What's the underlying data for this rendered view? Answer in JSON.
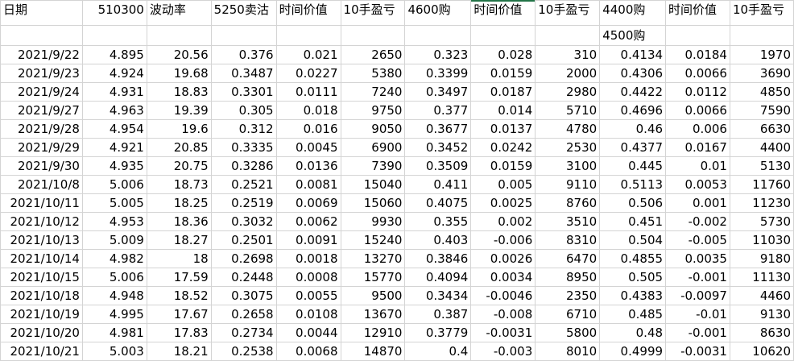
{
  "headers": [
    "日期",
    "510300",
    "波动率",
    "5250卖沽",
    "时间价值",
    "10手盈亏",
    "4600购",
    "时间价值",
    "10手盈亏",
    "4400购",
    "时间价值",
    "10手盈亏"
  ],
  "subheader": [
    "",
    "",
    "",
    "",
    "",
    "",
    "",
    "",
    "",
    "4500购",
    "",
    ""
  ],
  "rows": [
    [
      "2021/9/22",
      "4.895",
      "20.56",
      "0.376",
      "0.021",
      "2650",
      "0.323",
      "0.028",
      "310",
      "0.4134",
      "0.0184",
      "1970"
    ],
    [
      "2021/9/23",
      "4.924",
      "19.68",
      "0.3487",
      "0.0227",
      "5380",
      "0.3399",
      "0.0159",
      "2000",
      "0.4306",
      "0.0066",
      "3690"
    ],
    [
      "2021/9/24",
      "4.931",
      "18.83",
      "0.3301",
      "0.0111",
      "7240",
      "0.3497",
      "0.0187",
      "2980",
      "0.4422",
      "0.0112",
      "4850"
    ],
    [
      "2021/9/27",
      "4.963",
      "19.39",
      "0.305",
      "0.018",
      "9750",
      "0.377",
      "0.014",
      "5710",
      "0.4696",
      "0.0066",
      "7590"
    ],
    [
      "2021/9/28",
      "4.954",
      "19.6",
      "0.312",
      "0.016",
      "9050",
      "0.3677",
      "0.0137",
      "4780",
      "0.46",
      "0.006",
      "6630"
    ],
    [
      "2021/9/29",
      "4.921",
      "20.85",
      "0.3335",
      "0.0045",
      "6900",
      "0.3452",
      "0.0242",
      "2530",
      "0.4377",
      "0.0167",
      "4400"
    ],
    [
      "2021/9/30",
      "4.935",
      "20.75",
      "0.3286",
      "0.0136",
      "7390",
      "0.3509",
      "0.0159",
      "3100",
      "0.445",
      "0.01",
      "5130"
    ],
    [
      "2021/10/8",
      "5.006",
      "18.73",
      "0.2521",
      "0.0081",
      "15040",
      "0.411",
      "0.005",
      "9110",
      "0.5113",
      "0.0053",
      "11760"
    ],
    [
      "2021/10/11",
      "5.005",
      "18.25",
      "0.2519",
      "0.0069",
      "15060",
      "0.4075",
      "0.0025",
      "8760",
      "0.506",
      "0.001",
      "11230"
    ],
    [
      "2021/10/12",
      "4.953",
      "18.36",
      "0.3032",
      "0.0062",
      "9930",
      "0.355",
      "0.002",
      "3510",
      "0.451",
      "-0.002",
      "5730"
    ],
    [
      "2021/10/13",
      "5.009",
      "18.27",
      "0.2501",
      "0.0091",
      "15240",
      "0.403",
      "-0.006",
      "8310",
      "0.504",
      "-0.005",
      "11030"
    ],
    [
      "2021/10/14",
      "4.982",
      "18",
      "0.2698",
      "0.0018",
      "13270",
      "0.3846",
      "0.0026",
      "6470",
      "0.4855",
      "0.0035",
      "9180"
    ],
    [
      "2021/10/15",
      "5.006",
      "17.59",
      "0.2448",
      "0.0008",
      "15770",
      "0.4094",
      "0.0034",
      "8950",
      "0.505",
      "-0.001",
      "11130"
    ],
    [
      "2021/10/18",
      "4.948",
      "18.52",
      "0.3075",
      "0.0055",
      "9500",
      "0.3434",
      "-0.0046",
      "2350",
      "0.4383",
      "-0.0097",
      "4460"
    ],
    [
      "2021/10/19",
      "4.995",
      "17.67",
      "0.2658",
      "0.0108",
      "13670",
      "0.387",
      "-0.008",
      "6710",
      "0.485",
      "-0.01",
      "9130"
    ],
    [
      "2021/10/20",
      "4.981",
      "17.83",
      "0.2734",
      "0.0044",
      "12910",
      "0.3779",
      "-0.0031",
      "5800",
      "0.48",
      "-0.001",
      "8630"
    ],
    [
      "2021/10/21",
      "5.003",
      "18.21",
      "0.2538",
      "0.0068",
      "14870",
      "0.4",
      "-0.003",
      "8010",
      "0.4999",
      "-0.0031",
      "10620"
    ]
  ]
}
